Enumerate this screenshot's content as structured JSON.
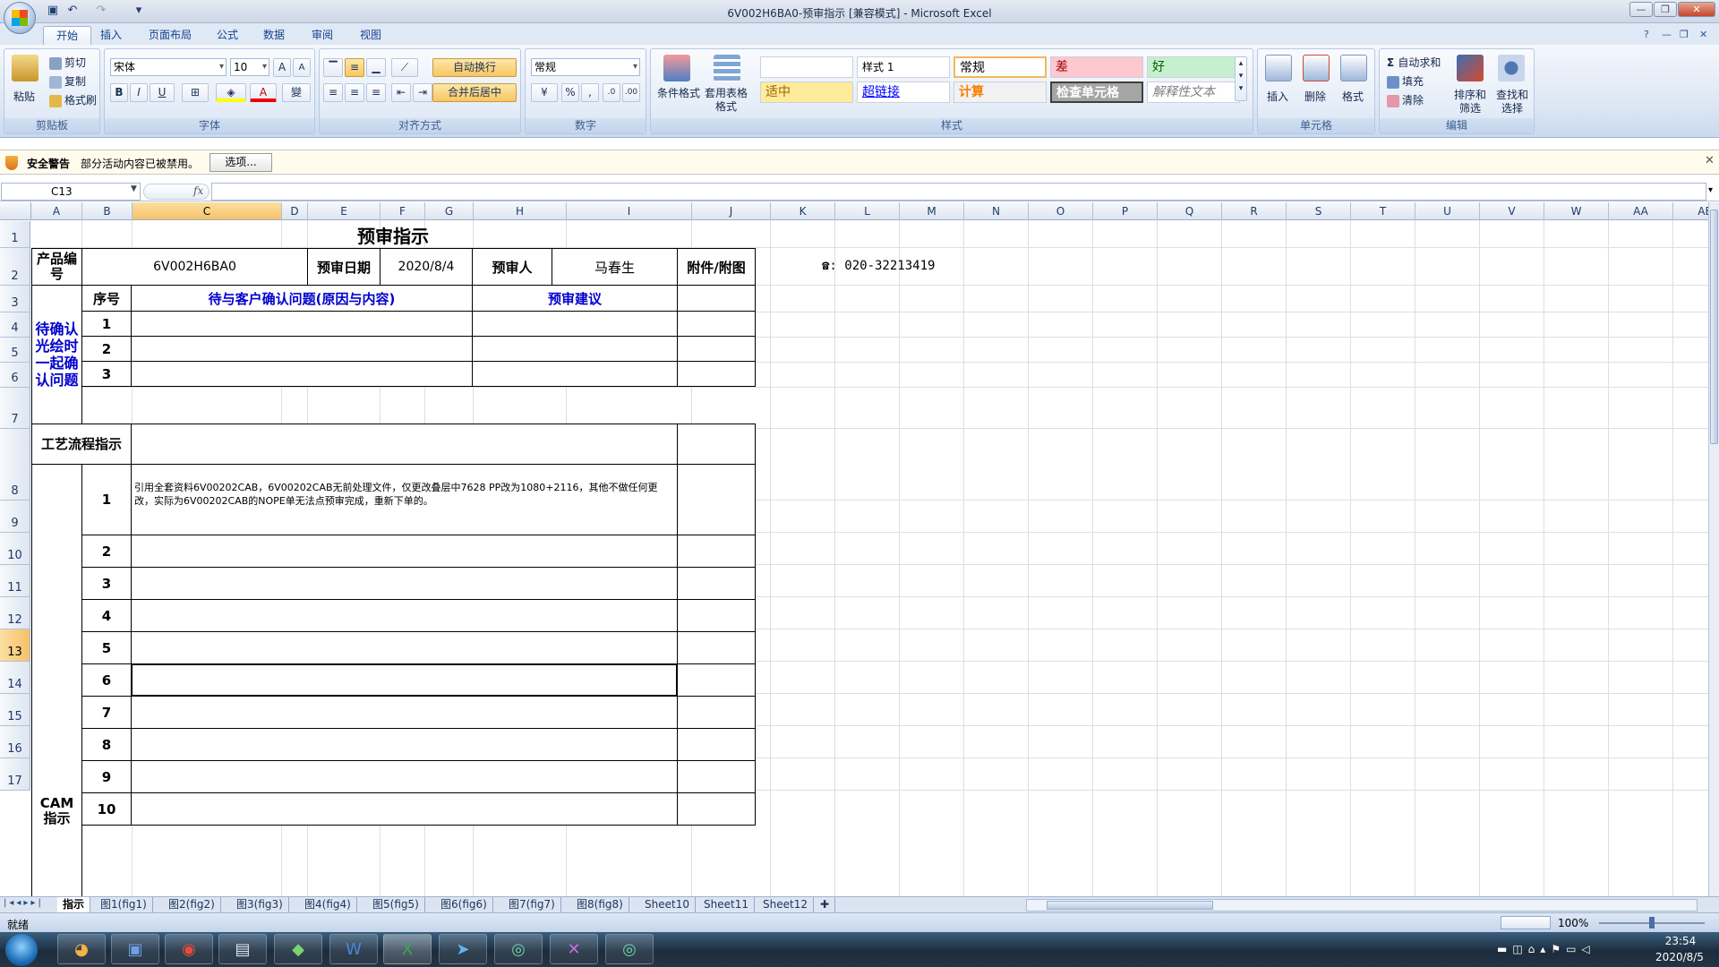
{
  "window": {
    "title": "6V002H6BA0-预审指示 [兼容模式] - Microsoft Excel"
  },
  "ribbon_tabs": [
    "开始",
    "插入",
    "页面布局",
    "公式",
    "数据",
    "审阅",
    "视图"
  ],
  "clipboard": {
    "paste": "粘贴",
    "cut": "剪切",
    "copy": "复制",
    "format_painter": "格式刷",
    "group": "剪贴板"
  },
  "font": {
    "name": "宋体",
    "size": "10",
    "bold": "B",
    "italic": "I",
    "underline": "U",
    "group": "字体"
  },
  "alignment": {
    "wrap": "自动换行",
    "merge": "合并后居中",
    "group": "对齐方式"
  },
  "number": {
    "format": "常规",
    "percent": "%",
    "comma": ",",
    "group": "数字"
  },
  "styles": {
    "cond_format": "条件格式",
    "table_format": "套用表格格式",
    "group": "样式",
    "items": [
      "",
      "样式 1",
      "常规",
      "差",
      "好",
      "适中",
      "超链接",
      "计算",
      "检查单元格",
      "解释性文本"
    ]
  },
  "cells": {
    "insert": "插入",
    "delete": "删除",
    "format": "格式",
    "group": "单元格"
  },
  "editing": {
    "autosum": "自动求和",
    "fill": "填充",
    "clear": "清除",
    "sort": "排序和筛选",
    "find": "查找和选择",
    "group": "编辑"
  },
  "security": {
    "title": "安全警告",
    "message": "部分活动内容已被禁用。",
    "options": "选项..."
  },
  "formula": {
    "namebox": "C13",
    "fx": "fx",
    "content": ""
  },
  "columns": [
    "A",
    "B",
    "C",
    "D",
    "E",
    "F",
    "G",
    "H",
    "I",
    "J",
    "K",
    "L",
    "M",
    "N",
    "O",
    "P",
    "Q",
    "R",
    "S",
    "T",
    "U",
    "V",
    "W",
    "AA",
    "AB"
  ],
  "rows": [
    "1",
    "2",
    "3",
    "4",
    "5",
    "6",
    "7",
    "8",
    "9",
    "10",
    "11",
    "12",
    "13",
    "14",
    "15",
    "16",
    "17"
  ],
  "sheet": {
    "title": "预审指示",
    "product_label": "产品编号",
    "product_value": "6V002H6BA0",
    "date_label": "预审日期",
    "date_value": "2020/8/4",
    "reviewer_label": "预审人",
    "reviewer_value": "马春生",
    "attach_label": "附件/附图",
    "phone": "☎: 020-32213419",
    "confirm_section": "待确认光绘时一起确认问题",
    "seq_label": "序号",
    "issue_label": "待与客户确认问题(原因与内容)",
    "advice_label": "预审建议",
    "confirm_rows": [
      "1",
      "2",
      "3"
    ],
    "process_label": "工艺流程指示",
    "cam_label": "CAM指示",
    "cam_rows": [
      "1",
      "2",
      "3",
      "4",
      "5",
      "6",
      "7",
      "8",
      "9",
      "10"
    ],
    "cam_note": "引用全套资料6V00202CAB，6V00202CAB无前处理文件，仅更改叠层中7628 PP改为1080+2116，其他不做任何更改，实际为6V00202CAB的NOPE单无法点预审完成，重新下单的。"
  },
  "sheet_tabs": [
    "指示",
    "图1(fig1)",
    "图2(fig2)",
    "图3(fig3)",
    "图4(fig4)",
    "图5(fig5)",
    "图6(fig6)",
    "图7(fig7)",
    "图8(fig8)",
    "Sheet10",
    "Sheet11",
    "Sheet12"
  ],
  "status": {
    "ready": "就绪",
    "zoom": "100%"
  },
  "clock": {
    "time": "23:54",
    "date": "2020/8/5"
  }
}
